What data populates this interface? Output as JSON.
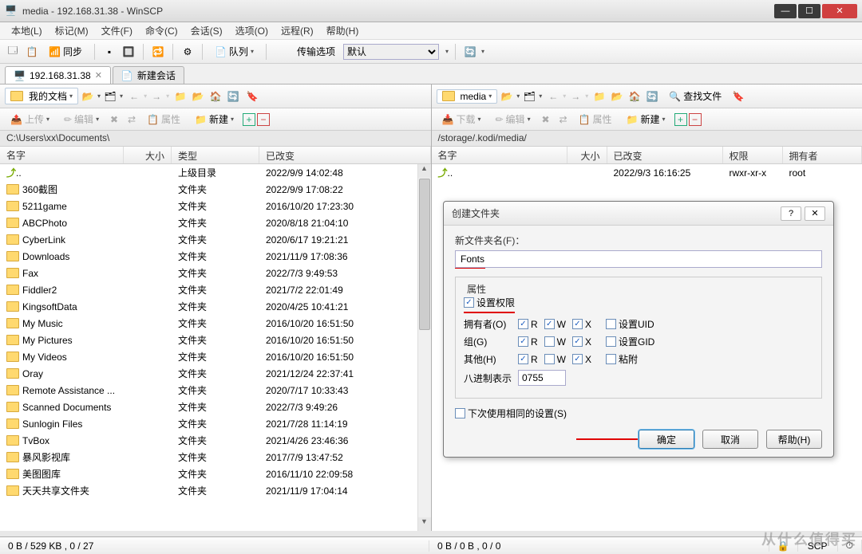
{
  "window": {
    "title": "media - 192.168.31.38 - WinSCP"
  },
  "menu": [
    "本地(L)",
    "标记(M)",
    "文件(F)",
    "命令(C)",
    "会话(S)",
    "选项(O)",
    "远程(R)",
    "帮助(H)"
  ],
  "toolbar1": {
    "sync_label": "同步",
    "queue_label": "队列",
    "transfer_label": "传输选项",
    "transfer_preset": "默认"
  },
  "tabs": {
    "active": "192.168.31.38",
    "new": "新建会话"
  },
  "left": {
    "location": "我的文档",
    "path": "C:\\Users\\xx\\Documents\\",
    "actions": {
      "upload": "上传",
      "edit": "编辑",
      "props": "属性",
      "new": "新建"
    },
    "cols": [
      "名字",
      "大小",
      "类型",
      "已改变"
    ],
    "parent_type": "上级目录",
    "parent_date": "2022/9/9  14:02:48",
    "rows": [
      {
        "name": "360截图",
        "type": "文件夹",
        "date": "2022/9/9  17:08:22"
      },
      {
        "name": "5211game",
        "type": "文件夹",
        "date": "2016/10/20  17:23:30"
      },
      {
        "name": "ABCPhoto",
        "type": "文件夹",
        "date": "2020/8/18  21:04:10"
      },
      {
        "name": "CyberLink",
        "type": "文件夹",
        "date": "2020/6/17  19:21:21"
      },
      {
        "name": "Downloads",
        "type": "文件夹",
        "date": "2021/11/9  17:08:36"
      },
      {
        "name": "Fax",
        "type": "文件夹",
        "date": "2022/7/3  9:49:53"
      },
      {
        "name": "Fiddler2",
        "type": "文件夹",
        "date": "2021/7/2  22:01:49"
      },
      {
        "name": "KingsoftData",
        "type": "文件夹",
        "date": "2020/4/25  10:41:21"
      },
      {
        "name": "My Music",
        "type": "文件夹",
        "date": "2016/10/20  16:51:50"
      },
      {
        "name": "My Pictures",
        "type": "文件夹",
        "date": "2016/10/20  16:51:50"
      },
      {
        "name": "My Videos",
        "type": "文件夹",
        "date": "2016/10/20  16:51:50"
      },
      {
        "name": "Oray",
        "type": "文件夹",
        "date": "2021/12/24  22:37:41"
      },
      {
        "name": "Remote Assistance ...",
        "type": "文件夹",
        "date": "2020/7/17  10:33:43"
      },
      {
        "name": "Scanned Documents",
        "type": "文件夹",
        "date": "2022/7/3  9:49:26"
      },
      {
        "name": "Sunlogin Files",
        "type": "文件夹",
        "date": "2021/7/28  11:14:19"
      },
      {
        "name": "TvBox",
        "type": "文件夹",
        "date": "2021/4/26  23:46:36"
      },
      {
        "name": "暴风影视库",
        "type": "文件夹",
        "date": "2017/7/9  13:47:52"
      },
      {
        "name": "美图图库",
        "type": "文件夹",
        "date": "2016/11/10  22:09:58"
      },
      {
        "name": "天天共享文件夹",
        "type": "文件夹",
        "date": "2021/11/9  17:04:14"
      }
    ],
    "status": "0 B / 529 KB ,   0 / 27"
  },
  "right": {
    "location": "media",
    "path": "/storage/.kodi/media/",
    "actions": {
      "download": "下载",
      "edit": "编辑",
      "props": "属性",
      "new": "新建",
      "find": "查找文件"
    },
    "cols": [
      "名字",
      "大小",
      "已改变",
      "权限",
      "拥有者"
    ],
    "parent_date": "2022/9/3 16:16:25",
    "parent_perm": "rwxr-xr-x",
    "parent_owner": "root",
    "status": "0 B / 0 B ,   0 / 0"
  },
  "dialog": {
    "title": "创建文件夹",
    "label_name": "新文件夹名(F)：",
    "name_value": "Fonts",
    "attrs_title": "属性",
    "set_perm": "设置权限",
    "owner": "拥有者(O)",
    "group": "组(G)",
    "others": "其他(H)",
    "R": "R",
    "W": "W",
    "X": "X",
    "uid": "设置UID",
    "gid": "设置GID",
    "sticky": "粘附",
    "octal_label": "八进制表示",
    "octal_value": "0755",
    "reuse": "下次使用相同的设置(S)",
    "ok": "确定",
    "cancel": "取消",
    "help": "帮助(H)"
  },
  "footer": {
    "protocol": "SCP"
  },
  "watermark": "从什么值得买"
}
